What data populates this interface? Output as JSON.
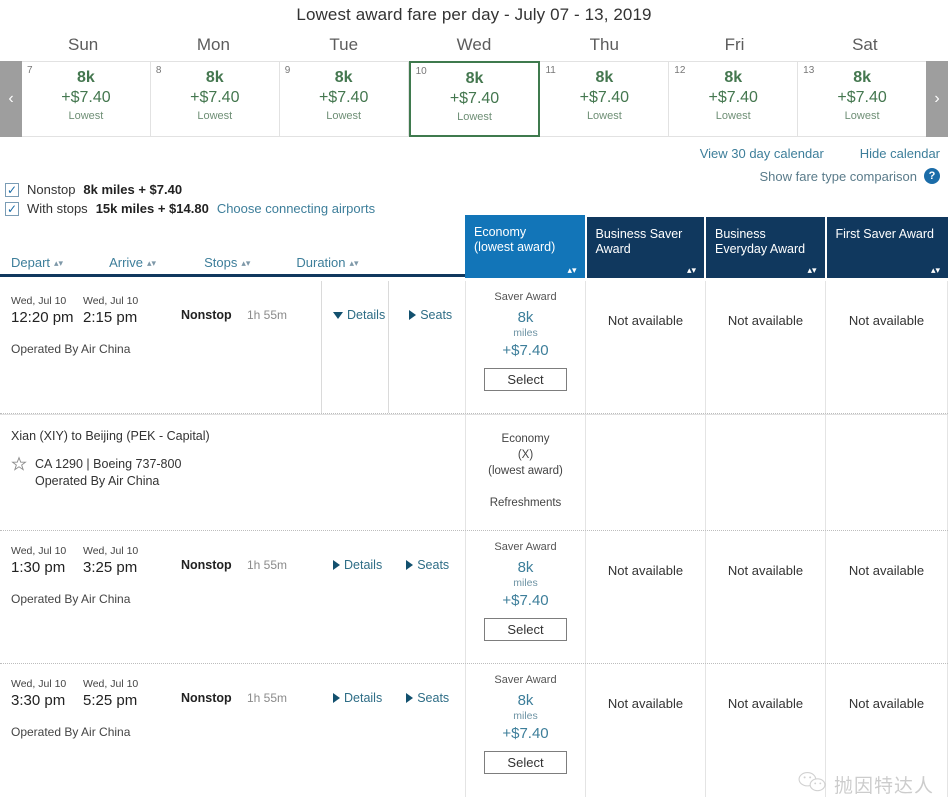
{
  "calendar": {
    "title": "Lowest award fare per day - July 07 - 13, 2019",
    "prev_arrow": "‹",
    "next_arrow": "›",
    "weekdays": [
      "Sun",
      "Mon",
      "Tue",
      "Wed",
      "Thu",
      "Fri",
      "Sat"
    ],
    "days": [
      {
        "daynum": "7",
        "miles": "8k",
        "tax": "+$7.40",
        "note": "Lowest",
        "selected": false
      },
      {
        "daynum": "8",
        "miles": "8k",
        "tax": "+$7.40",
        "note": "Lowest",
        "selected": false
      },
      {
        "daynum": "9",
        "miles": "8k",
        "tax": "+$7.40",
        "note": "Lowest",
        "selected": false
      },
      {
        "daynum": "10",
        "miles": "8k",
        "tax": "+$7.40",
        "note": "Lowest",
        "selected": true
      },
      {
        "daynum": "11",
        "miles": "8k",
        "tax": "+$7.40",
        "note": "Lowest",
        "selected": false
      },
      {
        "daynum": "12",
        "miles": "8k",
        "tax": "+$7.40",
        "note": "Lowest",
        "selected": false
      },
      {
        "daynum": "13",
        "miles": "8k",
        "tax": "+$7.40",
        "note": "Lowest",
        "selected": false
      }
    ],
    "selected_border_color": "#3f7a4e",
    "fare_color": "#44774f"
  },
  "links": {
    "view_30_day": "View 30 day calendar",
    "hide_calendar": "Hide calendar",
    "show_fare_comparison": "Show fare type comparison",
    "help_glyph": "?"
  },
  "filters": {
    "checkmark": "✓",
    "nonstop": {
      "label": "Nonstop",
      "value": "8k miles + $7.40"
    },
    "with_stops": {
      "label": "With stops",
      "value": "15k miles + $14.80",
      "link": "Choose connecting airports"
    }
  },
  "sort": {
    "glyph": "▴▾",
    "columns": [
      "Depart",
      "Arrive",
      "Stops",
      "Duration"
    ]
  },
  "fare_columns": [
    {
      "line1": "Economy",
      "line2": "(lowest award)",
      "active": true,
      "color": "#1275b8"
    },
    {
      "line1": "Business Saver",
      "line2": "Award",
      "active": false,
      "color": "#10385e"
    },
    {
      "line1": "Business",
      "line2": "Everyday Award",
      "active": false,
      "color": "#10385e"
    },
    {
      "line1": "First Saver Award",
      "line2": "",
      "active": false,
      "color": "#10385e"
    }
  ],
  "flights": [
    {
      "depart_date": "Wed, Jul 10",
      "depart_time": "12:20 pm",
      "arrive_date": "Wed, Jul 10",
      "arrive_time": "2:15 pm",
      "stops": "Nonstop",
      "duration": "1h 55m",
      "details_label": "Details",
      "seats_label": "Seats",
      "operated_by": "Operated By Air China",
      "expanded": true,
      "fares": {
        "economy": {
          "type_label": "Saver Award",
          "miles": "8k",
          "miles_unit": "miles",
          "tax": "+$7.40",
          "select_label": "Select"
        },
        "business_saver": "Not available",
        "business_everyday": "Not available",
        "first_saver": "Not available"
      },
      "details_panel": {
        "route": "Xian (XIY) to Beijing (PEK - Capital)",
        "flight_info": "CA 1290 | Boeing 737-800",
        "operated_by": "Operated By Air China",
        "cabin_line1": "Economy",
        "cabin_line2": "(X)",
        "cabin_line3": "(lowest award)",
        "amenity": "Refreshments"
      }
    },
    {
      "depart_date": "Wed, Jul 10",
      "depart_time": "1:30 pm",
      "arrive_date": "Wed, Jul 10",
      "arrive_time": "3:25 pm",
      "stops": "Nonstop",
      "duration": "1h 55m",
      "details_label": "Details",
      "seats_label": "Seats",
      "operated_by": "Operated By Air China",
      "expanded": false,
      "fares": {
        "economy": {
          "type_label": "Saver Award",
          "miles": "8k",
          "miles_unit": "miles",
          "tax": "+$7.40",
          "select_label": "Select"
        },
        "business_saver": "Not available",
        "business_everyday": "Not available",
        "first_saver": "Not available"
      }
    },
    {
      "depart_date": "Wed, Jul 10",
      "depart_time": "3:30 pm",
      "arrive_date": "Wed, Jul 10",
      "arrive_time": "5:25 pm",
      "stops": "Nonstop",
      "duration": "1h 55m",
      "details_label": "Details",
      "seats_label": "Seats",
      "operated_by": "Operated By Air China",
      "expanded": false,
      "fares": {
        "economy": {
          "type_label": "Saver Award",
          "miles": "8k",
          "miles_unit": "miles",
          "tax": "+$7.40",
          "select_label": "Select"
        },
        "business_saver": "Not available",
        "business_everyday": "Not available",
        "first_saver": "Not available"
      }
    }
  ],
  "watermark": {
    "text": "抛因特达人"
  }
}
